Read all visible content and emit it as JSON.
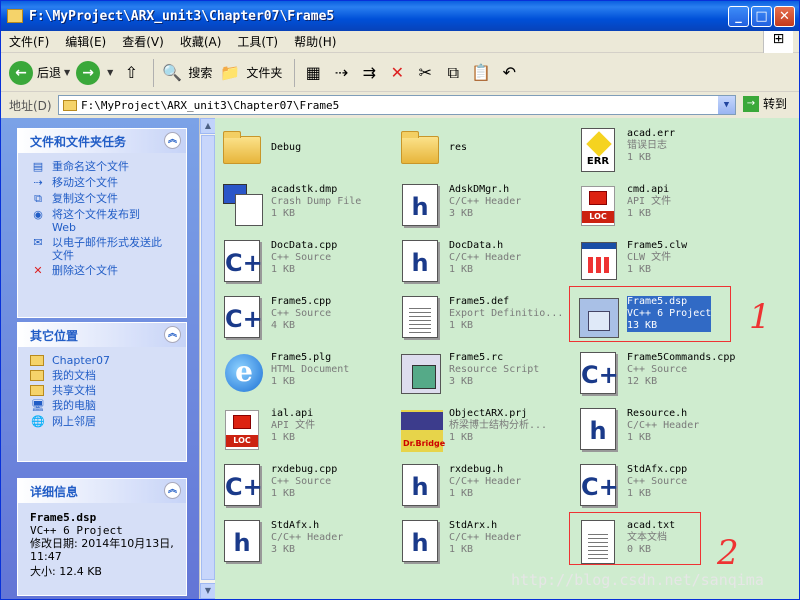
{
  "window": {
    "title": "F:\\MyProject\\ARX_unit3\\Chapter07\\Frame5"
  },
  "menu": [
    "文件(F)",
    "编辑(E)",
    "查看(V)",
    "收藏(A)",
    "工具(T)",
    "帮助(H)"
  ],
  "toolbar": {
    "back": "后退",
    "search": "搜索",
    "folders": "文件夹"
  },
  "address": {
    "label": "地址(D)",
    "value": "F:\\MyProject\\ARX_unit3\\Chapter07\\Frame5",
    "go": "转到"
  },
  "tasks": {
    "title": "文件和文件夹任务",
    "items": [
      "重命名这个文件",
      "移动这个文件",
      "复制这个文件",
      "将这个文件发布到 Web",
      "以电子邮件形式发送此文件",
      "删除这个文件"
    ]
  },
  "places": {
    "title": "其它位置",
    "items": [
      "Chapter07",
      "我的文档",
      "共享文档",
      "我的电脑",
      "网上邻居"
    ]
  },
  "details": {
    "title": "详细信息",
    "name": "Frame5.dsp",
    "type": "VC++ 6 Project",
    "modified": "修改日期: 2014年10月13日, 11:47",
    "size": "大小: 12.4 KB"
  },
  "files": [
    {
      "name": "Debug",
      "type": "",
      "size": "",
      "icon": "folder"
    },
    {
      "name": "res",
      "type": "",
      "size": "",
      "icon": "folder"
    },
    {
      "name": "acad.err",
      "type": "错误日志",
      "size": "1 KB",
      "icon": "err"
    },
    {
      "name": "acadstk.dmp",
      "type": "Crash Dump File",
      "size": "1 KB",
      "icon": "dmp"
    },
    {
      "name": "AdskDMgr.h",
      "type": "C/C++ Header",
      "size": "3 KB",
      "icon": "h"
    },
    {
      "name": "cmd.api",
      "type": "API 文件",
      "size": "1 KB",
      "icon": "loc"
    },
    {
      "name": "DocData.cpp",
      "type": "C++ Source",
      "size": "1 KB",
      "icon": "cpp"
    },
    {
      "name": "DocData.h",
      "type": "C/C++ Header",
      "size": "1 KB",
      "icon": "h"
    },
    {
      "name": "Frame5.clw",
      "type": "CLW 文件",
      "size": "1 KB",
      "icon": "clw"
    },
    {
      "name": "Frame5.cpp",
      "type": "C++ Source",
      "size": "4 KB",
      "icon": "cpp"
    },
    {
      "name": "Frame5.def",
      "type": "Export Definitio...",
      "size": "1 KB",
      "icon": "def"
    },
    {
      "name": "Frame5.dsp",
      "type": "VC++ 6 Project",
      "size": "13 KB",
      "icon": "dsp",
      "selected": true
    },
    {
      "name": "Frame5.plg",
      "type": "HTML Document",
      "size": "1 KB",
      "icon": "ie"
    },
    {
      "name": "Frame5.rc",
      "type": "Resource Script",
      "size": "3 KB",
      "icon": "rc"
    },
    {
      "name": "Frame5Commands.cpp",
      "type": "C++ Source",
      "size": "12 KB",
      "icon": "cpp"
    },
    {
      "name": "ial.api",
      "type": "API 文件",
      "size": "1 KB",
      "icon": "loc"
    },
    {
      "name": "ObjectARX.prj",
      "type": "桥梁博士结构分析...",
      "size": "1 KB",
      "icon": "prj"
    },
    {
      "name": "Resource.h",
      "type": "C/C++ Header",
      "size": "1 KB",
      "icon": "h"
    },
    {
      "name": "rxdebug.cpp",
      "type": "C++ Source",
      "size": "1 KB",
      "icon": "cpp"
    },
    {
      "name": "rxdebug.h",
      "type": "C/C++ Header",
      "size": "1 KB",
      "icon": "h"
    },
    {
      "name": "StdAfx.cpp",
      "type": "C++ Source",
      "size": "1 KB",
      "icon": "cpp"
    },
    {
      "name": "StdAfx.h",
      "type": "C/C++ Header",
      "size": "3 KB",
      "icon": "h"
    },
    {
      "name": "StdArx.h",
      "type": "C/C++ Header",
      "size": "1 KB",
      "icon": "h"
    },
    {
      "name": "acad.txt",
      "type": "文本文档",
      "size": "0 KB",
      "icon": "txt"
    }
  ],
  "annotations": [
    "1",
    "2"
  ],
  "watermark": "http://blog.csdn.net/sanqima"
}
